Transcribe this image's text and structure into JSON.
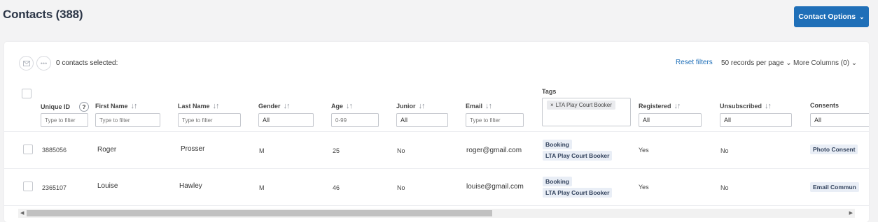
{
  "header": {
    "title": "Contacts (388)",
    "options_label": "Contact Options",
    "options_chevron": "⌄"
  },
  "toolbar": {
    "selected_text": "0 contacts selected:",
    "reset_filters": "Reset filters",
    "records_per_page": "50 records per page ⌄",
    "more_columns": "More Columns (0) ⌄"
  },
  "columns": {
    "unique_id": {
      "label": "Unique ID",
      "help": "?",
      "placeholder": "Type to filter"
    },
    "first_name": {
      "label": "First Name",
      "placeholder": "Type to filter"
    },
    "last_name": {
      "label": "Last Name",
      "placeholder": "Type to filter"
    },
    "gender": {
      "label": "Gender",
      "value": "All"
    },
    "age": {
      "label": "Age",
      "placeholder": "0-99"
    },
    "junior": {
      "label": "Junior",
      "value": "All"
    },
    "email": {
      "label": "Email",
      "placeholder": "Type to filter"
    },
    "tags": {
      "label": "Tags",
      "chip": "LTA Play Court Booker",
      "chip_remove": "×"
    },
    "registered": {
      "label": "Registered",
      "value": "All"
    },
    "unsubscribed": {
      "label": "Unsubscribed",
      "value": "All"
    },
    "consents": {
      "label": "Consents",
      "value": "All"
    }
  },
  "sort_icons": "↓↑",
  "rows": [
    {
      "unique_id": "3885056",
      "first_name": "Roger",
      "last_name": "Prosser",
      "gender": "M",
      "age": "25",
      "junior": "No",
      "email": "roger@gmail.com",
      "tags": [
        "Booking",
        "LTA Play Court Booker"
      ],
      "registered": "Yes",
      "unsubscribed": "No",
      "consents": "Photo Consent"
    },
    {
      "unique_id": "2365107",
      "first_name": "Louise",
      "last_name": "Hawley",
      "gender": "M",
      "age": "46",
      "junior": "No",
      "email": "louise@gmail.com",
      "tags": [
        "Booking",
        "LTA Play Court Booker"
      ],
      "registered": "Yes",
      "unsubscribed": "No",
      "consents": "Email Commun"
    }
  ],
  "scrollbar": {
    "position": 0.0,
    "visible_fraction": 0.56
  },
  "colors": {
    "accent": "#1f6fb8",
    "tag_bg": "#e9eef6",
    "tag_text": "#33435d"
  }
}
